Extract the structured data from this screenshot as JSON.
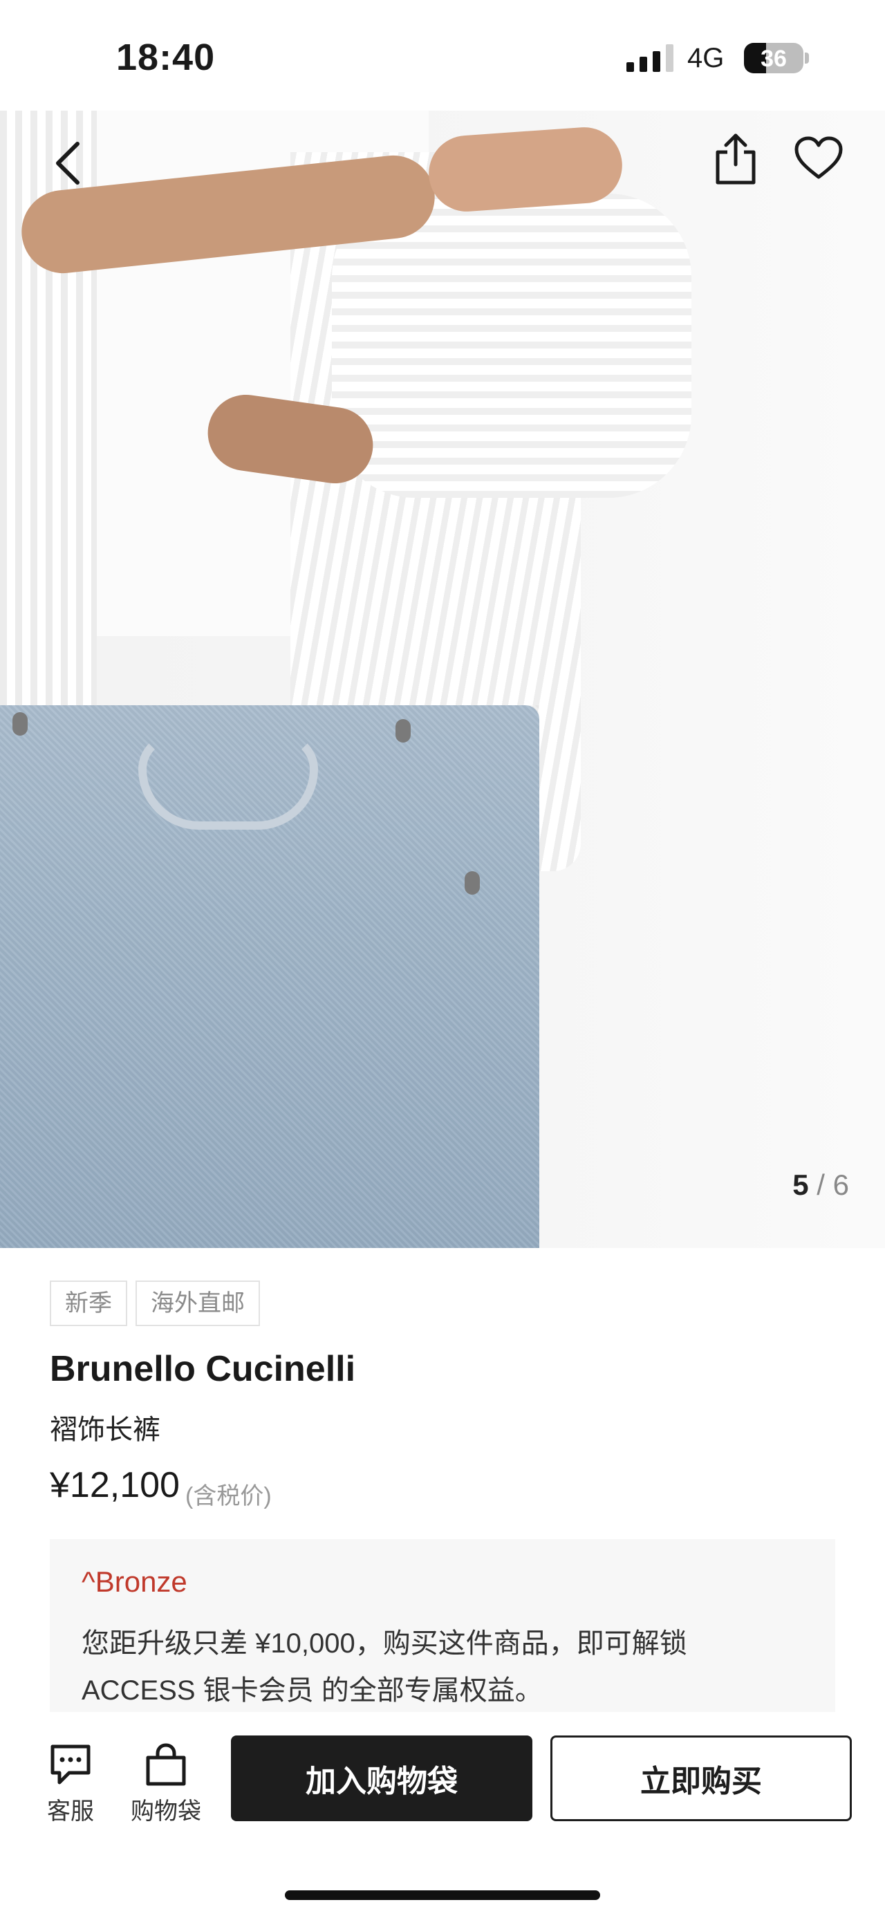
{
  "status_bar": {
    "time": "18:40",
    "network": "4G",
    "battery": "36"
  },
  "gallery": {
    "current": "5",
    "separator": "/",
    "total": "6"
  },
  "icons": {
    "back": "chevron-left-icon",
    "share": "share-icon",
    "favorite": "heart-icon",
    "service": "chat-bubble-icon",
    "bag": "shopping-bag-icon"
  },
  "product": {
    "tags": [
      "新季",
      "海外直邮"
    ],
    "brand": "Brunello Cucinelli",
    "name": "褶饰长裤",
    "price": "¥12,100",
    "price_note": "(含税价)"
  },
  "membership": {
    "tier": "^Bronze",
    "line1": "您距升级只差 ¥10,000，购买这件商品，即可解锁",
    "line2": "ACCESS 银卡会员 的全部专属权益。",
    "tier_color": "#c0392b"
  },
  "actions": {
    "service_label": "客服",
    "bag_label": "购物袋",
    "add_to_bag": "加入购物袋",
    "buy_now": "立即购买"
  }
}
